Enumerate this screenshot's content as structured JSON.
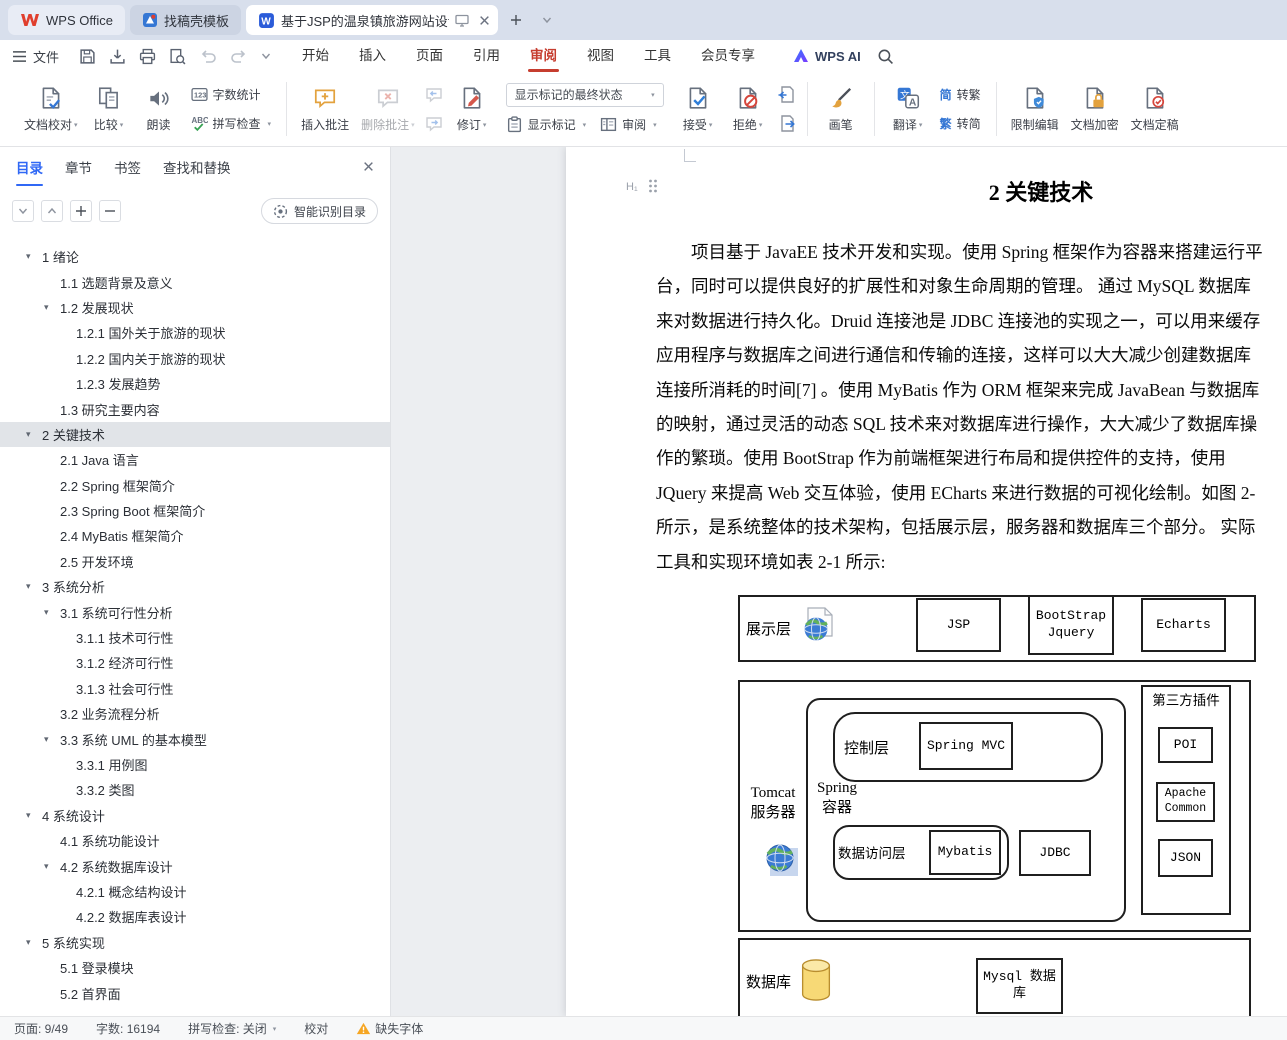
{
  "colors": {
    "accent_red": "#c63d2f",
    "accent_blue": "#3068f5",
    "tabbar_bg": "#d8dfec",
    "toc_selection_bg": "#e1e4e8",
    "warning_yellow": "#f6a623",
    "doc_icon_blue": "#2b5cd9",
    "canvas_bg": "#eceef1"
  },
  "titlebar": {
    "home_tab": "WPS Office",
    "template_tab": "找稿壳模板",
    "doc_tab": "基于JSP的温泉镇旅游网站设计"
  },
  "menubar": {
    "file_label": "文件",
    "items": [
      {
        "id": "home",
        "label": "开始",
        "active": false
      },
      {
        "id": "insert",
        "label": "插入",
        "active": false
      },
      {
        "id": "page",
        "label": "页面",
        "active": false
      },
      {
        "id": "reference",
        "label": "引用",
        "active": false
      },
      {
        "id": "review",
        "label": "审阅",
        "active": true
      },
      {
        "id": "view",
        "label": "视图",
        "active": false
      },
      {
        "id": "tools",
        "label": "工具",
        "active": false
      },
      {
        "id": "membership",
        "label": "会员专享",
        "active": false
      }
    ],
    "wps_ai_label": "WPS AI"
  },
  "ribbon": {
    "items": [
      {
        "type": "big",
        "name": "doc-proofread-button",
        "icon": "doc-proofread-icon",
        "label": "文档校对",
        "dropdown": true
      },
      {
        "type": "big",
        "name": "compare-button",
        "icon": "compare-icon",
        "label": "比较",
        "dropdown": true
      },
      {
        "type": "big",
        "name": "read-aloud-button",
        "icon": "read-aloud-icon",
        "label": "朗读"
      },
      {
        "type": "stack",
        "items": [
          {
            "name": "word-count-button",
            "icon": "word-count-icon",
            "label": "字数统计"
          },
          {
            "name": "spell-check-button",
            "icon": "spell-check-icon",
            "label": "拼写检查",
            "dropdown": true
          }
        ]
      },
      {
        "type": "divider"
      },
      {
        "type": "big",
        "name": "insert-comment-button",
        "icon": "insert-comment-icon",
        "label": "插入批注"
      },
      {
        "type": "big",
        "name": "delete-comment-button",
        "icon": "delete-comment-icon",
        "label": "删除批注",
        "dropdown": true,
        "disabled": true
      },
      {
        "type": "navstack",
        "items": [
          {
            "name": "prev-comment-button",
            "icon": "prev-comment-icon",
            "disabled": true
          },
          {
            "name": "next-comment-button",
            "icon": "next-comment-icon",
            "disabled": true
          }
        ]
      },
      {
        "type": "big",
        "name": "track-changes-button",
        "icon": "track-changes-icon",
        "label": "修订",
        "dropdown": true
      },
      {
        "type": "markup-panel",
        "select": {
          "name": "markup-state-select",
          "value": "显示标记的最终状态"
        },
        "row": [
          {
            "name": "show-markup-button",
            "icon": "show-markup-icon",
            "label": "显示标记",
            "dropdown": true
          },
          {
            "name": "review-pane-button",
            "icon": "review-pane-icon",
            "label": "审阅",
            "dropdown": true
          }
        ]
      },
      {
        "type": "big",
        "name": "accept-change-button",
        "icon": "accept-icon",
        "label": "接受",
        "dropdown": true
      },
      {
        "type": "big",
        "name": "reject-change-button",
        "icon": "reject-icon",
        "label": "拒绝",
        "dropdown": true
      },
      {
        "type": "navstack",
        "items": [
          {
            "name": "prev-change-button",
            "icon": "prev-change-icon",
            "disabled": false
          },
          {
            "name": "next-change-button",
            "icon": "next-change-icon",
            "disabled": false
          }
        ]
      },
      {
        "type": "divider"
      },
      {
        "type": "big",
        "name": "ink-brush-button",
        "icon": "brush-icon",
        "label": "画笔"
      },
      {
        "type": "divider"
      },
      {
        "type": "big",
        "name": "translate-button",
        "icon": "translate-icon",
        "label": "翻译",
        "dropdown": true
      },
      {
        "type": "stack",
        "items": [
          {
            "name": "simplified-to-traditional-button",
            "icon": "jian-char-icon",
            "label": "转繁"
          },
          {
            "name": "traditional-to-simplified-button",
            "icon": "fan-char-icon",
            "label": "转简"
          }
        ]
      },
      {
        "type": "divider"
      },
      {
        "type": "big",
        "name": "restrict-editing-button",
        "icon": "restrict-edit-icon",
        "label": "限制编辑"
      },
      {
        "type": "big",
        "name": "encrypt-doc-button",
        "icon": "encrypt-icon",
        "label": "文档加密"
      },
      {
        "type": "big",
        "name": "finalize-doc-button",
        "icon": "finalize-icon",
        "label": "文档定稿"
      }
    ]
  },
  "sidebar": {
    "tabs": [
      {
        "id": "toc",
        "label": "目录",
        "active": true
      },
      {
        "id": "chapters",
        "label": "章节",
        "active": false
      },
      {
        "id": "bookmarks",
        "label": "书签",
        "active": false
      },
      {
        "id": "find-replace",
        "label": "查找和替换",
        "active": false
      }
    ],
    "smart_toc_button": "智能识别目录",
    "toc": [
      {
        "label": "1 绪论",
        "level": 1,
        "expandable": true
      },
      {
        "label": "1.1 选题背景及意义",
        "level": 2
      },
      {
        "label": "1.2 发展现状",
        "level": 2,
        "expandable": true
      },
      {
        "label": "1.2.1 国外关于旅游的现状",
        "level": 3
      },
      {
        "label": "1.2.2 国内关于旅游的现状",
        "level": 3
      },
      {
        "label": "1.2.3 发展趋势",
        "level": 3
      },
      {
        "label": "1.3 研究主要内容",
        "level": 2
      },
      {
        "label": "2 关键技术",
        "level": 1,
        "expandable": true,
        "selected": true
      },
      {
        "label": "2.1 Java 语言",
        "level": 2
      },
      {
        "label": "2.2 Spring 框架简介",
        "level": 2
      },
      {
        "label": "2.3 Spring Boot 框架简介",
        "level": 2
      },
      {
        "label": "2.4 MyBatis 框架简介",
        "level": 2
      },
      {
        "label": "2.5 开发环境",
        "level": 2
      },
      {
        "label": "3 系统分析",
        "level": 1,
        "expandable": true
      },
      {
        "label": "3.1 系统可行性分析",
        "level": 2,
        "expandable": true
      },
      {
        "label": "3.1.1 技术可行性",
        "level": 3
      },
      {
        "label": "3.1.2 经济可行性",
        "level": 3
      },
      {
        "label": "3.1.3 社会可行性",
        "level": 3
      },
      {
        "label": "3.2 业务流程分析",
        "level": 2
      },
      {
        "label": "3.3 系统 UML 的基本模型",
        "level": 2,
        "expandable": true
      },
      {
        "label": "3.3.1 用例图",
        "level": 3
      },
      {
        "label": "3.3.2 类图",
        "level": 3
      },
      {
        "label": "4 系统设计",
        "level": 1,
        "expandable": true
      },
      {
        "label": "4.1 系统功能设计",
        "level": 2
      },
      {
        "label": "4.2 系统数据库设计",
        "level": 2,
        "expandable": true
      },
      {
        "label": "4.2.1 概念结构设计",
        "level": 3
      },
      {
        "label": "4.2.2 数据库表设计",
        "level": 3
      },
      {
        "label": "5 系统实现",
        "level": 1,
        "expandable": true
      },
      {
        "label": "5.1 登录模块",
        "level": 2
      },
      {
        "label": "5.2 首界面",
        "level": 2
      }
    ]
  },
  "document": {
    "heading": "2  关键技术",
    "heading_level_badge": "H₁",
    "para_lines": [
      "项目基于 JavaEE 技术开发和实现。使用 Spring 框架作为容器来搭建运行平",
      "台，同时可以提供良好的扩展性和对象生命周期的管理。 通过 MySQL 数据库",
      "来对数据进行持久化。Druid 连接池是 JDBC 连接池的实现之一，可以用来缓存",
      "应用程序与数据库之间进行通信和传输的连接，这样可以大大减少创建数据库",
      "连接所消耗的时间[7] 。使用 MyBatis 作为 ORM 框架来完成 JavaBean 与数据库",
      "的映射，通过灵活的动态 SQL 技术来对数据库进行操作，大大减少了数据库操",
      "作的繁琐。使用 BootStrap 作为前端框架进行布局和提供控件的支持，使用",
      "JQuery 来提高 Web 交互体验，使用 ECharts 来进行数据的可视化绘制。如图 2-",
      "所示，是系统整体的技术架构，包括展示层，服务器和数据库三个部分。 实际",
      "工具和实现环境如表 2-1 所示:"
    ],
    "diagram": {
      "presentation_label": "展示层",
      "jsp": "JSP",
      "bootstrap_line1": "BootStrap",
      "bootstrap_line2": "Jquery",
      "echarts": "Echarts",
      "tomcat_line1": "Tomcat",
      "tomcat_line2": "服务器",
      "spring_line1": "Spring",
      "spring_line2": "容器",
      "control_label": "控制层",
      "spring_mvc": "Spring MVC",
      "dao_label": "数据访问层",
      "mybatis": "Mybatis",
      "jdbc": "JDBC",
      "plugins_label": "第三方插件",
      "poi": "POI",
      "apache_line1": "Apache",
      "apache_line2": "Common",
      "json": "JSON",
      "db_label": "数据库",
      "mysql_line1": "Mysql 数据",
      "mysql_line2": "库"
    }
  },
  "statusbar": {
    "page": "页面: 9/49",
    "words": "字数: 16194",
    "spellcheck": "拼写检查: 关闭",
    "proofread": "校对",
    "missing_font": "缺失字体"
  }
}
